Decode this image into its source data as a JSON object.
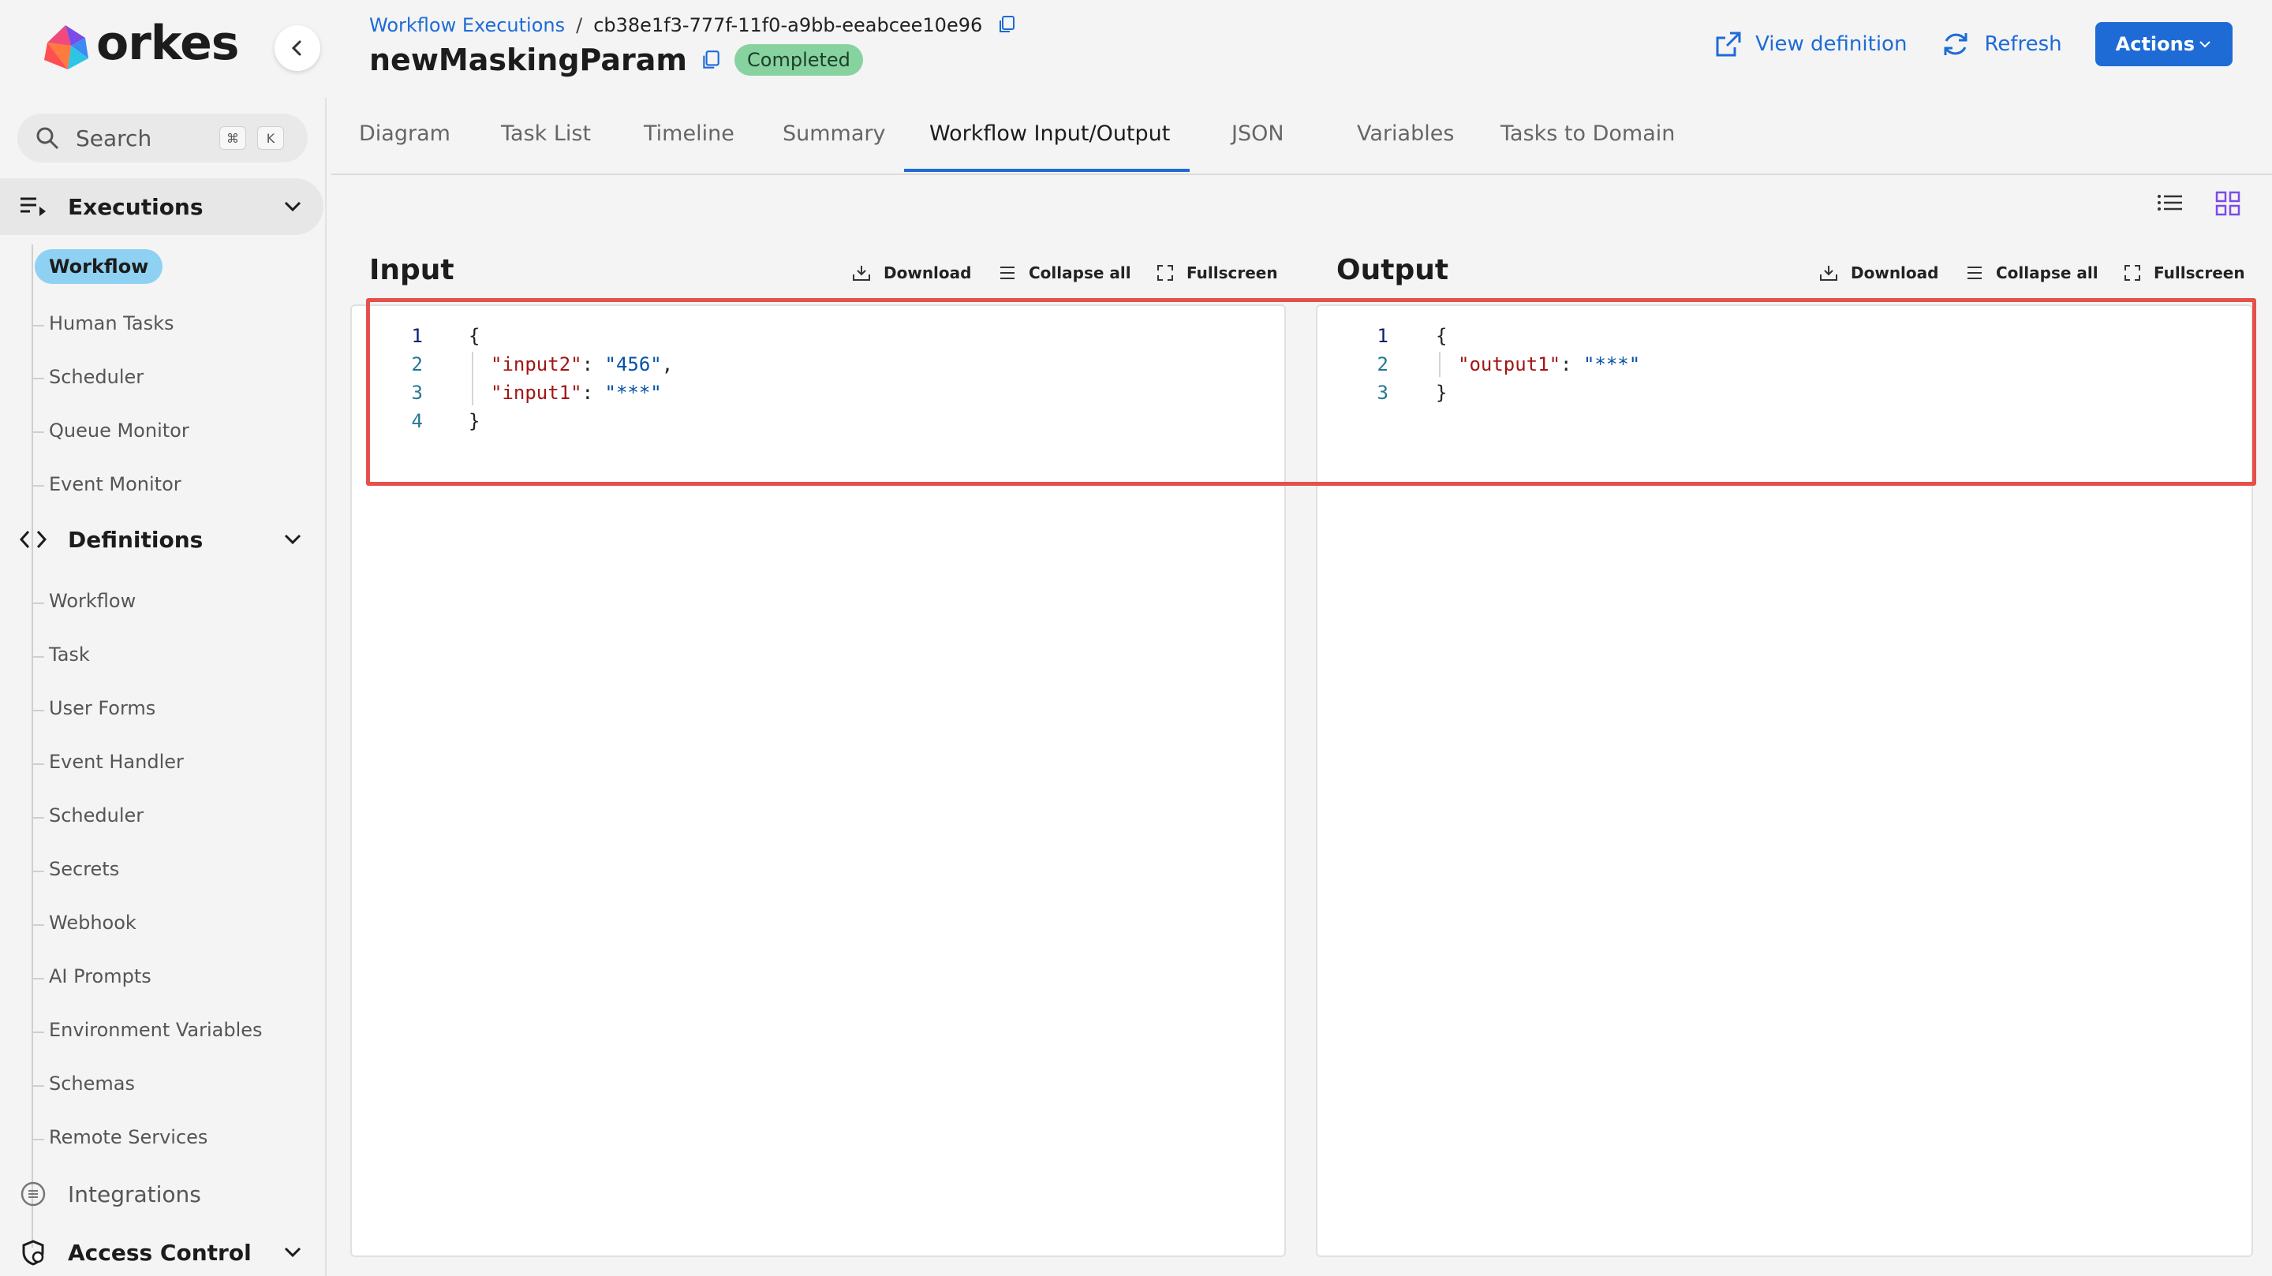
{
  "brand": {
    "name": "orkes"
  },
  "breadcrumb": {
    "parent": "Workflow Executions",
    "separator": "/",
    "execution_id": "cb38e1f3-777f-11f0-a9bb-eeabcee10e96"
  },
  "header": {
    "title": "newMaskingParam",
    "status": "Completed",
    "view_definition": "View definition",
    "refresh": "Refresh",
    "actions": "Actions"
  },
  "sidebar": {
    "search_placeholder": "Search",
    "shortcut_keys": [
      "⌘",
      "K"
    ],
    "sections": [
      {
        "label": "Executions",
        "items": [
          "Workflow",
          "Human Tasks",
          "Scheduler",
          "Queue Monitor",
          "Event Monitor"
        ],
        "active_item": "Workflow"
      },
      {
        "label": "Definitions",
        "items": [
          "Workflow",
          "Task",
          "User Forms",
          "Event Handler",
          "Scheduler",
          "Secrets",
          "Webhook",
          "AI Prompts",
          "Environment Variables",
          "Schemas",
          "Remote Services"
        ]
      },
      {
        "label": "Integrations"
      },
      {
        "label": "Access Control"
      }
    ]
  },
  "tabs": [
    "Diagram",
    "Task List",
    "Timeline",
    "Summary",
    "Workflow Input/Output",
    "JSON",
    "Variables",
    "Tasks to Domain"
  ],
  "active_tab": "Workflow Input/Output",
  "tools": {
    "download": "Download",
    "collapse_all": "Collapse all",
    "fullscreen": "Fullscreen"
  },
  "input_panel": {
    "title": "Input",
    "lines": [
      {
        "n": "1",
        "t": "{"
      },
      {
        "n": "2",
        "key": "\"input2\"",
        "val": "\"456\"",
        "comma": ","
      },
      {
        "n": "3",
        "key": "\"input1\"",
        "val": "\"***\""
      },
      {
        "n": "4",
        "t": "}"
      }
    ]
  },
  "output_panel": {
    "title": "Output",
    "lines": [
      {
        "n": "1",
        "t": "{"
      },
      {
        "n": "2",
        "key": "\"output1\"",
        "val": "\"***\""
      },
      {
        "n": "3",
        "t": "}"
      }
    ]
  },
  "colors": {
    "accent": "#1e6bd6",
    "status_green": "#86d3a0",
    "active_nav": "#8fd1f2",
    "highlight": "#e5514a",
    "json_key": "#a31515",
    "json_string": "#0451a5"
  }
}
